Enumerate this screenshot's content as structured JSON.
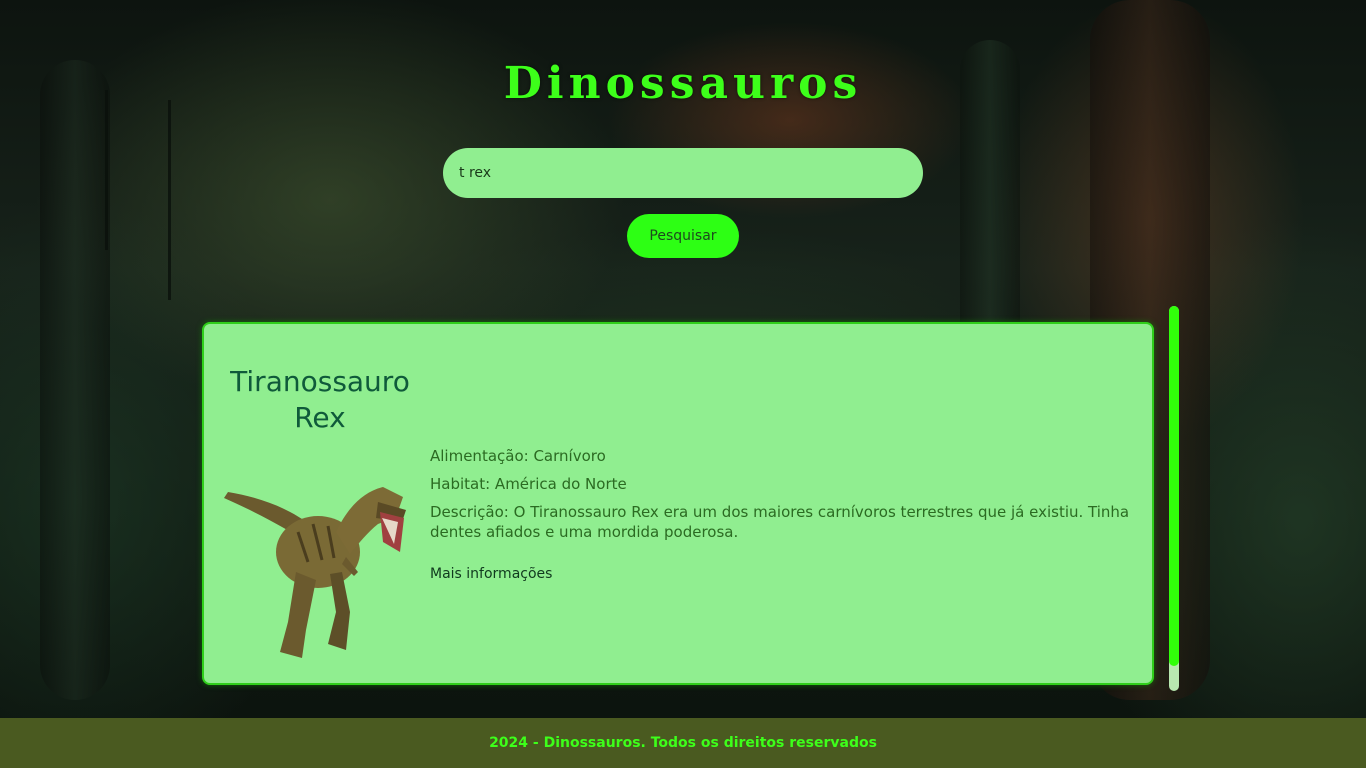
{
  "header": {
    "title": "Dinossauros"
  },
  "search": {
    "value": "t rex",
    "button_label": "Pesquisar"
  },
  "result": {
    "name": "Tiranossauro Rex",
    "alimentacao": "Alimentação: Carnívoro",
    "habitat": "Habitat: América do Norte",
    "descricao": "Descrição: O Tiranossauro Rex era um dos maiores carnívoros terrestres que já existiu. Tinha dentes afiados e uma mordida poderosa.",
    "link_label": "Mais informações"
  },
  "footer": {
    "text": "2024 - Dinossauros. Todos os direitos reservados"
  },
  "colors": {
    "accent": "#3dff1a",
    "card_bg": "#90ee90",
    "footer_bg": "#4a5a20"
  }
}
